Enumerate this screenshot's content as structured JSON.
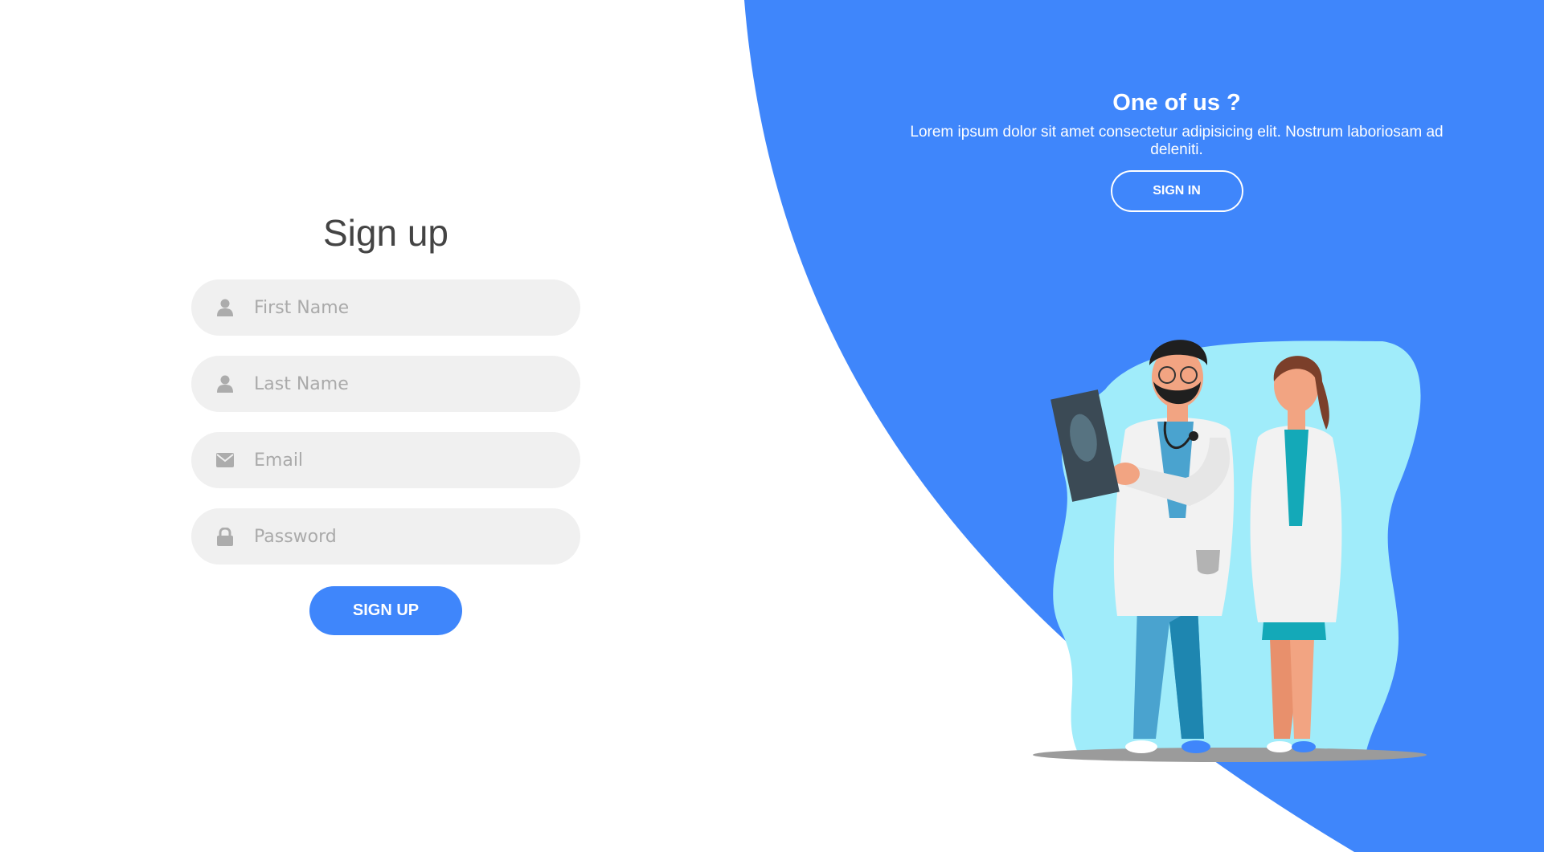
{
  "signup": {
    "title": "Sign up",
    "fields": [
      {
        "icon": "user-icon",
        "placeholder": "First Name",
        "type": "text"
      },
      {
        "icon": "user-icon",
        "placeholder": "Last Name",
        "type": "text"
      },
      {
        "icon": "envelope-icon",
        "placeholder": "Email",
        "type": "email"
      },
      {
        "icon": "lock-icon",
        "placeholder": "Password",
        "type": "password"
      }
    ],
    "button_label": "SIGN UP"
  },
  "panel": {
    "title": "One of us ?",
    "text": "Lorem ipsum dolor sit amet consectetur adipisicing elit. Nostrum laboriosam ad deleniti.",
    "button_label": "SIGN IN"
  },
  "colors": {
    "accent": "#3f86fb",
    "input_bg": "#f0f0f0",
    "icon_gray": "#acacac",
    "illustration_blob": "#a0ecfa"
  }
}
